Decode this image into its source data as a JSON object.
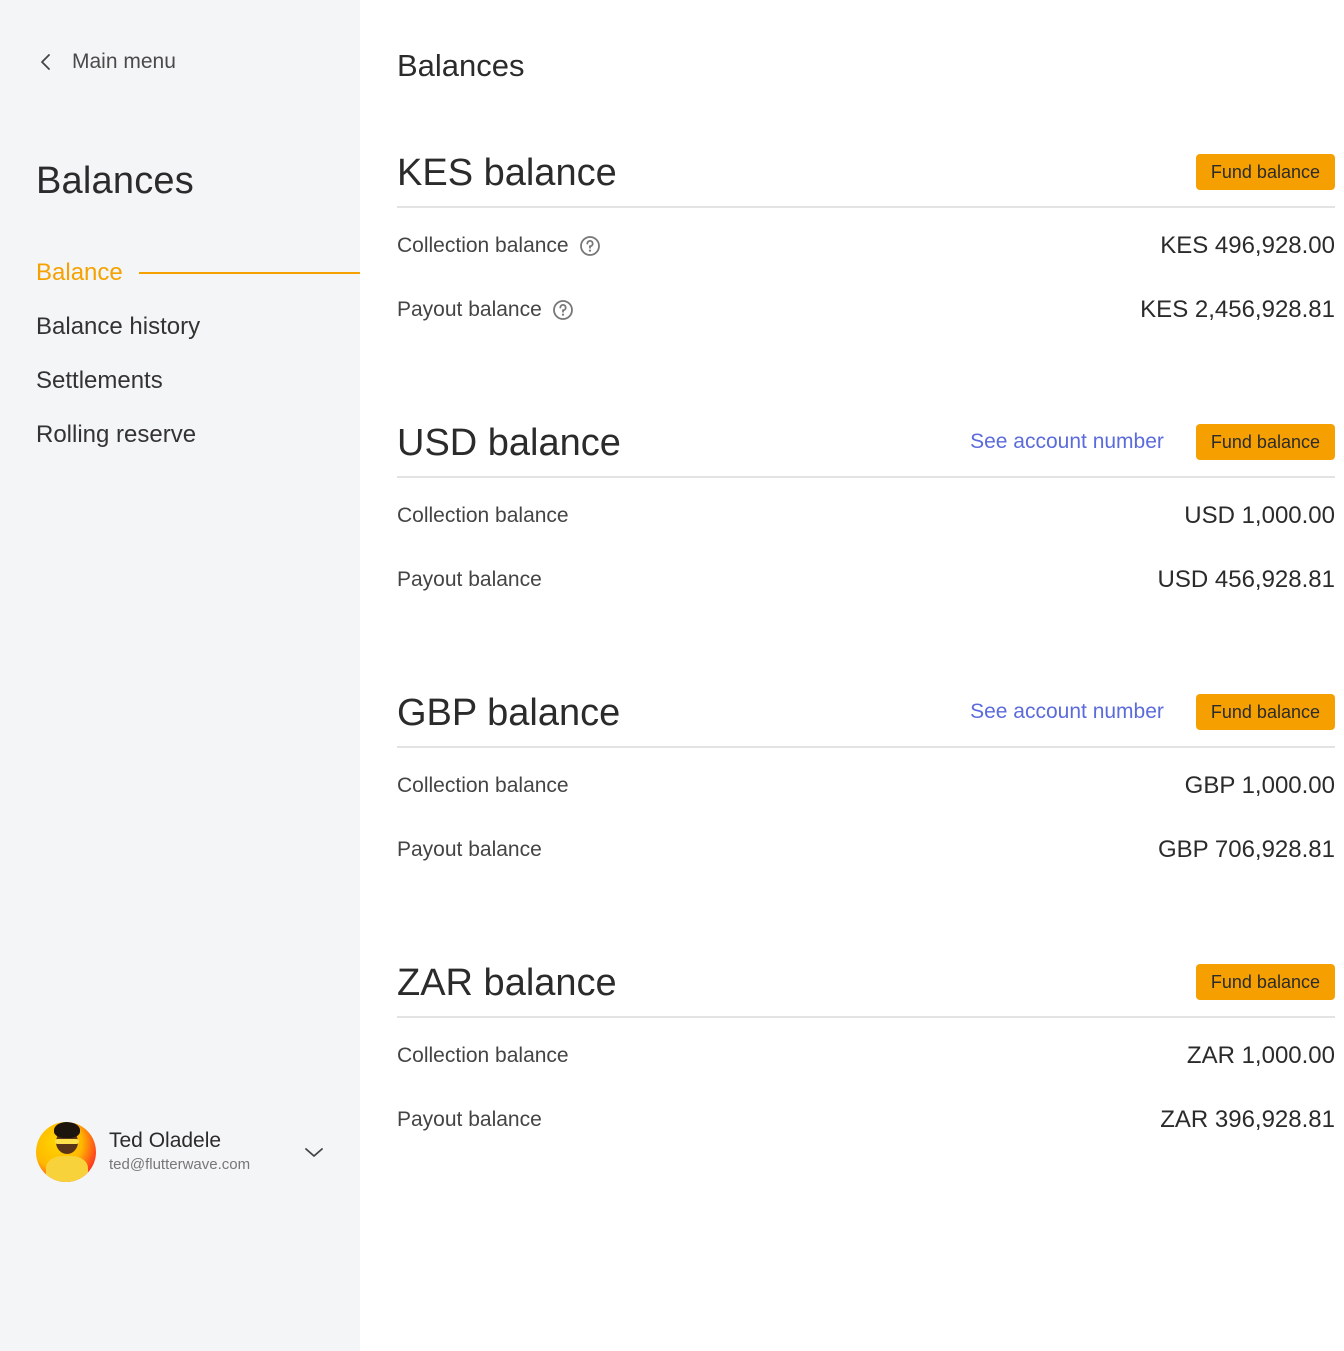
{
  "sidebar": {
    "back_label": "Main menu",
    "title": "Balances",
    "items": [
      {
        "label": "Balance",
        "active": true
      },
      {
        "label": "Balance history"
      },
      {
        "label": "Settlements"
      },
      {
        "label": "Rolling reserve"
      }
    ],
    "user": {
      "name": "Ted Oladele",
      "email": "ted@flutterwave.com"
    }
  },
  "main": {
    "title": "Balances",
    "cards": [
      {
        "title": "KES balance",
        "see_account": null,
        "fund_label": "Fund balance",
        "rows": [
          {
            "label": "Collection balance",
            "help": true,
            "value": "KES 496,928.00"
          },
          {
            "label": "Payout balance",
            "help": true,
            "value": "KES 2,456,928.81"
          }
        ]
      },
      {
        "title": "USD balance",
        "see_account": "See account number",
        "fund_label": "Fund balance",
        "rows": [
          {
            "label": "Collection balance",
            "value": "USD 1,000.00"
          },
          {
            "label": "Payout balance",
            "value": "USD 456,928.81"
          }
        ]
      },
      {
        "title": "GBP balance",
        "see_account": "See account number",
        "fund_label": "Fund balance",
        "rows": [
          {
            "label": "Collection balance",
            "value": "GBP 1,000.00"
          },
          {
            "label": "Payout balance",
            "value": "GBP 706,928.81"
          }
        ]
      },
      {
        "title": "ZAR balance",
        "see_account": null,
        "fund_label": "Fund balance",
        "rows": [
          {
            "label": "Collection balance",
            "value": "ZAR 1,000.00"
          },
          {
            "label": "Payout balance",
            "value": "ZAR 396,928.81"
          }
        ]
      }
    ]
  },
  "colors": {
    "accent": "#f5a200",
    "link": "#5b6bdc",
    "sidebar_bg": "#f4f5f7"
  }
}
